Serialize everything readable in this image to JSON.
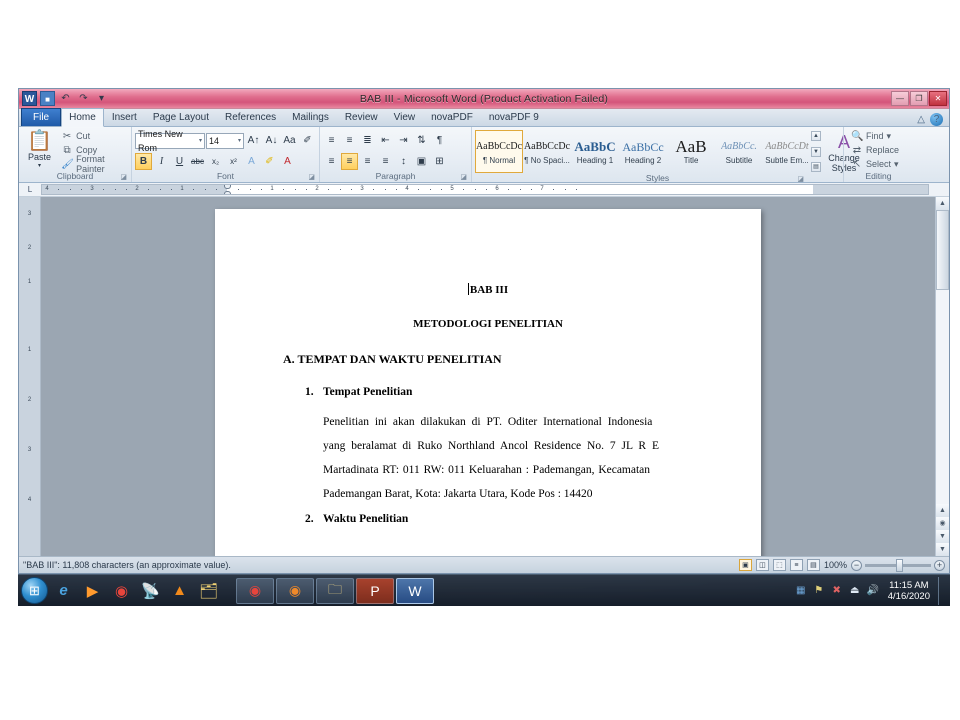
{
  "window": {
    "title": "BAB III - Microsoft Word (Product Activation Failed)",
    "app_icon": "W",
    "quick_access": [
      {
        "name": "save",
        "glyph": "■"
      },
      {
        "name": "undo",
        "glyph": "↶"
      },
      {
        "name": "redo",
        "glyph": "↷"
      },
      {
        "name": "customize",
        "glyph": "▾"
      }
    ],
    "controls": {
      "minimize": "—",
      "restore": "❐",
      "close": "✕"
    }
  },
  "tabs": [
    {
      "label": "File",
      "active": false,
      "file": true
    },
    {
      "label": "Home",
      "active": true
    },
    {
      "label": "Insert",
      "active": false
    },
    {
      "label": "Page Layout",
      "active": false
    },
    {
      "label": "References",
      "active": false
    },
    {
      "label": "Mailings",
      "active": false
    },
    {
      "label": "Review",
      "active": false
    },
    {
      "label": "View",
      "active": false
    },
    {
      "label": "novaPDF",
      "active": false
    },
    {
      "label": "novaPDF 9",
      "active": false
    }
  ],
  "tab_right_icons": [
    {
      "name": "minimize-ribbon-icon",
      "glyph": "△"
    },
    {
      "name": "help-icon",
      "glyph": "?"
    }
  ],
  "ribbon": {
    "clipboard": {
      "label": "Clipboard",
      "paste": {
        "label": "Paste",
        "glyph": "📋"
      },
      "items": [
        {
          "label": "Cut",
          "glyph": "✂"
        },
        {
          "label": "Copy",
          "glyph": "⧉"
        },
        {
          "label": "Format Painter",
          "glyph": "🖌"
        }
      ]
    },
    "font": {
      "label": "Font",
      "font_name": "Times New Rom",
      "font_size": "14",
      "row1": [
        {
          "name": "grow-font",
          "glyph": "A↑"
        },
        {
          "name": "shrink-font",
          "glyph": "A↓"
        },
        {
          "name": "change-case",
          "glyph": "Aa"
        },
        {
          "name": "clear-formatting",
          "glyph": "✐"
        }
      ],
      "row2": [
        {
          "name": "bold",
          "glyph": "B",
          "active": true
        },
        {
          "name": "italic",
          "glyph": "I",
          "active": false
        },
        {
          "name": "underline",
          "glyph": "U",
          "active": false
        },
        {
          "name": "strikethrough",
          "glyph": "abc",
          "active": false
        },
        {
          "name": "subscript",
          "glyph": "x₂",
          "active": false
        },
        {
          "name": "superscript",
          "glyph": "x²",
          "active": false
        },
        {
          "name": "text-effects",
          "glyph": "A",
          "active": false
        },
        {
          "name": "text-highlight-color",
          "glyph": "✐",
          "active": false
        },
        {
          "name": "font-color",
          "glyph": "A",
          "active": false
        }
      ]
    },
    "paragraph": {
      "label": "Paragraph",
      "row1": [
        {
          "name": "bullets",
          "glyph": "≡"
        },
        {
          "name": "numbering",
          "glyph": "≡"
        },
        {
          "name": "multilevel-list",
          "glyph": "≣"
        },
        {
          "name": "decrease-indent",
          "glyph": "⇤"
        },
        {
          "name": "increase-indent",
          "glyph": "⇥"
        },
        {
          "name": "sort",
          "glyph": "⇅"
        },
        {
          "name": "show-formatting-marks",
          "glyph": "¶"
        }
      ],
      "row2": [
        {
          "name": "align-left",
          "glyph": "≡",
          "active": false
        },
        {
          "name": "align-center",
          "glyph": "≡",
          "active": true
        },
        {
          "name": "align-right",
          "glyph": "≡",
          "active": false
        },
        {
          "name": "justify",
          "glyph": "≡",
          "active": false
        },
        {
          "name": "line-spacing",
          "glyph": "↕"
        },
        {
          "name": "shading",
          "glyph": "▣"
        },
        {
          "name": "borders",
          "glyph": "⊞"
        }
      ]
    },
    "styles": {
      "label": "Styles",
      "items": [
        {
          "preview": "AaBbCcDc",
          "name": "¶ Normal",
          "selected": true,
          "size": "10px",
          "weight": "normal",
          "color": "#1a1a1a"
        },
        {
          "preview": "AaBbCcDc",
          "name": "¶ No Spaci...",
          "selected": false,
          "size": "10px",
          "weight": "normal",
          "color": "#1a1a1a"
        },
        {
          "preview": "AaBbC",
          "name": "Heading 1",
          "selected": false,
          "size": "13px",
          "weight": "bold",
          "color": "#2a5d91"
        },
        {
          "preview": "AaBbCc",
          "name": "Heading 2",
          "selected": false,
          "size": "12px",
          "weight": "normal",
          "color": "#3a6fa5"
        },
        {
          "preview": "AaB",
          "name": "Title",
          "selected": false,
          "size": "17px",
          "weight": "normal",
          "color": "#1a1a1a"
        },
        {
          "preview": "AaBbCc.",
          "name": "Subtitle",
          "selected": false,
          "size": "10px",
          "weight": "normal",
          "color": "#6c8fb5"
        },
        {
          "preview": "AaBbCcDt",
          "name": "Subtle Em...",
          "selected": false,
          "size": "10px",
          "weight": "normal",
          "color": "#8a8a8a"
        }
      ],
      "change_styles": {
        "label1": "Change",
        "label2": "Styles",
        "glyph": "A"
      }
    },
    "editing": {
      "label": "Editing",
      "items": [
        {
          "label": "Find",
          "glyph": "🔍"
        },
        {
          "label": "Replace",
          "glyph": "⇄"
        },
        {
          "label": "Select",
          "glyph": "↖"
        }
      ]
    }
  },
  "ruler": {
    "corner": "L",
    "numbers": [
      "4",
      "3",
      "2",
      "1",
      "1",
      "2",
      "3",
      "4",
      "5",
      "6",
      "7"
    ],
    "vertical_numbers": [
      "3",
      "2",
      "1",
      "1",
      "2",
      "3",
      "4"
    ]
  },
  "document": {
    "heading_chapter": "BAB III",
    "heading_title": "METODOLOGI PENELITIAN",
    "section_a": "A. TEMPAT DAN WAKTU PENELITIAN",
    "item1_no": "1.",
    "item1_label": "Tempat Penelitian",
    "paragraph_lines": [
      "Penelitian ini akan dilakukan di PT. Oditer International Indonesia",
      "yang beralamat di Ruko Northland Ancol Residence No. 7 JL R E",
      "Martadinata RT: 011 RW: 011 Keluarahan : Pademangan, Kecamatan",
      "Pademangan Barat, Kota: Jakarta Utara, Kode Pos : 14420"
    ],
    "item2_no": "2.",
    "item2_label": "Waktu Penelitian"
  },
  "statusbar": {
    "text": "\"BAB III\": 11,808 characters (an approximate value).",
    "zoom": "100%",
    "view_buttons": [
      {
        "name": "print-layout-view",
        "glyph": "▣",
        "selected": true
      },
      {
        "name": "full-screen-reading-view",
        "glyph": "◫",
        "selected": false
      },
      {
        "name": "web-layout-view",
        "glyph": "⬚",
        "selected": false
      },
      {
        "name": "outline-view",
        "glyph": "≡",
        "selected": false
      },
      {
        "name": "draft-view",
        "glyph": "▤",
        "selected": false
      }
    ],
    "zoom_out": "−",
    "zoom_in": "+"
  },
  "taskbar": {
    "start_glyph": "⊞",
    "pinned": [
      {
        "name": "internet-explorer-icon",
        "glyph": "e",
        "color": "#4aa3e0"
      },
      {
        "name": "windows-media-player-icon",
        "glyph": "▶",
        "color": "#ff9a2e"
      },
      {
        "name": "google-chrome-icon",
        "glyph": "◉",
        "color": "#e8453c"
      },
      {
        "name": "satellite-dish-icon",
        "glyph": "📡",
        "color": "#dde7f0"
      },
      {
        "name": "vlc-player-icon",
        "glyph": "▲",
        "color": "#f28a1b"
      },
      {
        "name": "folder-stack-icon",
        "glyph": "🗂",
        "color": "#f2d374"
      }
    ],
    "tasks": [
      {
        "name": "taskbar-chrome",
        "glyph": "◉",
        "color": "#e8453c",
        "active": false
      },
      {
        "name": "taskbar-firefox",
        "glyph": "◉",
        "color": "#f0892a",
        "active": false
      },
      {
        "name": "taskbar-file-explorer",
        "glyph": "🗀",
        "color": "#f3d98a",
        "active": false
      },
      {
        "name": "taskbar-powerpoint",
        "glyph": "P",
        "color": "#d24726",
        "active": false
      },
      {
        "name": "taskbar-word",
        "glyph": "W",
        "color": "#2b579a",
        "active": true
      }
    ],
    "tray": [
      {
        "name": "network-icon",
        "glyph": "▦"
      },
      {
        "name": "action-center-icon",
        "glyph": "⚑"
      },
      {
        "name": "antivirus-icon",
        "glyph": "✖"
      },
      {
        "name": "usb-eject-icon",
        "glyph": "⏏"
      },
      {
        "name": "volume-icon",
        "glyph": "🔊"
      }
    ],
    "time": "11:15 AM",
    "date": "4/16/2020"
  }
}
